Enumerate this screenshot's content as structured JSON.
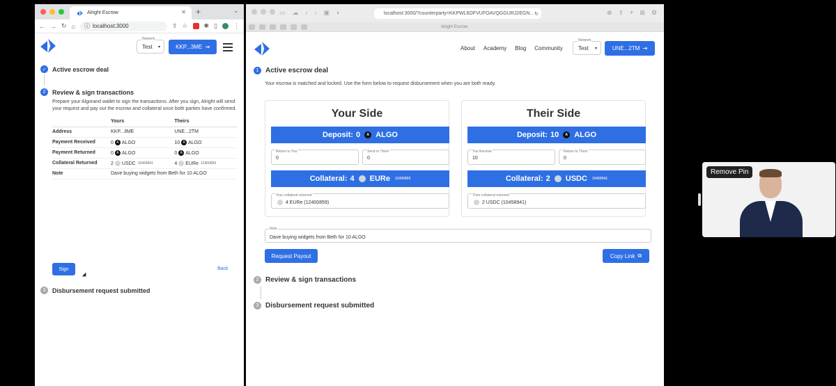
{
  "left_browser": {
    "tab_title": "Alright Escrow",
    "url": "localhost:3000"
  },
  "left_app": {
    "network_label": "Network",
    "network_value": "Test",
    "account_button": "KKP...3ME",
    "step1": {
      "num": "✓",
      "title": "Active escrow deal"
    },
    "step2": {
      "num": "2",
      "title": "Review & sign transactions",
      "description": "Prepare your Algorand wallet to sign the transactions. After you sign, Alright will send your request and pay out the escrow and collateral once both parties have confirmed."
    },
    "table": {
      "headers": [
        "",
        "Yours",
        "Theirs"
      ],
      "rows": [
        {
          "key": "Address",
          "yours": "KKP...3ME",
          "theirs": "UNE...2TM"
        },
        {
          "key": "Payment Received",
          "yours_amt": "0",
          "yours_unit": "ALGO",
          "theirs_amt": "10",
          "theirs_unit": "ALGO"
        },
        {
          "key": "Payment Returned",
          "yours_amt": "0",
          "yours_unit": "ALGO",
          "theirs_amt": "0",
          "theirs_unit": "ALGO"
        },
        {
          "key": "Collateral Returned",
          "yours_amt": "2",
          "yours_unit": "USDC",
          "yours_sub": "10458941",
          "theirs_amt": "4",
          "theirs_unit": "EURe",
          "theirs_sub": "12400859"
        },
        {
          "key": "Note",
          "value": "Dave buying widgets from Beth for 10 ALGO"
        }
      ]
    },
    "sign_button": "Sign",
    "back_link": "Back",
    "step3": {
      "num": "3",
      "title": "Disbursement request submitted"
    }
  },
  "right_browser": {
    "url": "localhost:3000/?counterparty=KKPWL6OFVUFOAVQGGURJ2EGN...",
    "tab_label": "Alright Escrow"
  },
  "right_app": {
    "nav": [
      "About",
      "Academy",
      "Blog",
      "Community"
    ],
    "network_label": "Network",
    "network_value": "Test",
    "account_button": "UNE...2TM",
    "step1": {
      "num": "1",
      "title": "Active escrow deal",
      "description": "Your escrow is matched and locked. Use the form below to request disbursement when you are both ready."
    },
    "your_side": {
      "title": "Your Side",
      "deposit_label": "Deposit:",
      "deposit_amt": "0",
      "deposit_unit": "ALGO",
      "return_to_you_label": "Return to You",
      "return_to_you": "0",
      "send_to_them_label": "Send to Them",
      "send_to_them": "0",
      "collateral_label": "Collateral:",
      "collateral_amt": "4",
      "collateral_unit": "EURe",
      "collateral_id": "12400859",
      "collateral_returned_label": "Your collateral returned",
      "collateral_returned": "4 EURe (12400859)"
    },
    "their_side": {
      "title": "Their Side",
      "deposit_label": "Deposit:",
      "deposit_amt": "10",
      "deposit_unit": "ALGO",
      "you_receive_label": "You Receive",
      "you_receive": "10",
      "return_to_them_label": "Return to Them",
      "return_to_them": "0",
      "collateral_label": "Collateral:",
      "collateral_amt": "2",
      "collateral_unit": "USDC",
      "collateral_id": "10458941",
      "collateral_returned_label": "Their collateral returned",
      "collateral_returned": "2 USDC (10458941)"
    },
    "note_label": "Note",
    "note_value": "Dave buying widgets from Beth for 10 ALGO",
    "request_payout_button": "Request Payout",
    "copy_link_button": "Copy Link",
    "step2": {
      "num": "2",
      "title": "Review & sign transactions"
    },
    "step3": {
      "num": "3",
      "title": "Disbursement request submitted"
    }
  },
  "video": {
    "pin_label": "Remove Pin"
  },
  "colors": {
    "accent": "#2f6fe4"
  }
}
